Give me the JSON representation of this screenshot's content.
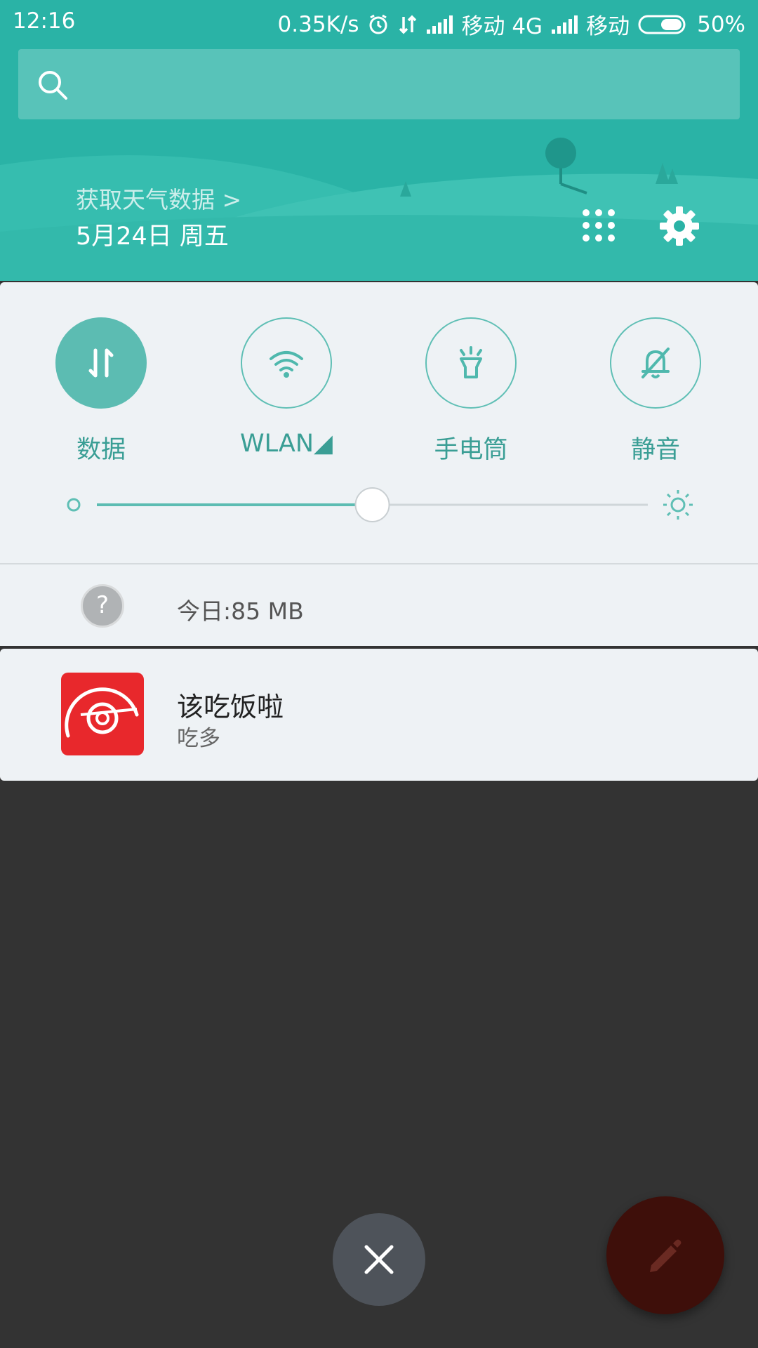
{
  "status_bar": {
    "time": "12:16",
    "net_speed": "0.35K/s",
    "carrier1": "移动 4G",
    "carrier2": "移动",
    "battery": "50%"
  },
  "header": {
    "search_placeholder": "",
    "weather_link": "获取天气数据 >",
    "date": "5月24日 周五"
  },
  "quick_toggles": [
    {
      "label": "数据",
      "active": true,
      "icon": "data-transfer-icon"
    },
    {
      "label": "WLAN◢",
      "active": false,
      "icon": "wifi-icon"
    },
    {
      "label": "手电筒",
      "active": false,
      "icon": "flashlight-icon"
    },
    {
      "label": "静音",
      "active": false,
      "icon": "mute-bell-icon"
    }
  ],
  "brightness": {
    "level": 0.5
  },
  "data_usage": {
    "text": "今日:85 MB",
    "help_symbol": "?"
  },
  "notification": {
    "title": "该吃饭啦",
    "subtitle": "吃多",
    "icon": "app-logo-icon"
  },
  "colors": {
    "header_bg": "#2ab3a6",
    "accent": "#5cbcb2",
    "panel_bg": "#eef2f5",
    "backdrop": "#333333",
    "app_icon": "#e8282c",
    "fab": "#3e0f0a"
  }
}
